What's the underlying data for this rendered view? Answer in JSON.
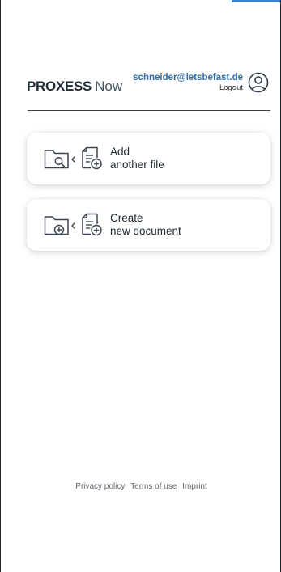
{
  "app": {
    "logo_brand": "PROXESS",
    "logo_suffix": "Now"
  },
  "account": {
    "email": "schneider@letsbefast.de",
    "logout_label": "Logout",
    "avatar_icon": "user-circle-icon"
  },
  "actions": [
    {
      "line1": "Add",
      "line2": "another file",
      "icons": [
        "folder-search-icon",
        "chevron-left-icon",
        "document-add-icon"
      ]
    },
    {
      "line1": "Create",
      "line2": "new document",
      "icons": [
        "folder-add-icon",
        "chevron-left-icon",
        "document-add-icon"
      ]
    }
  ],
  "footer": {
    "privacy": "Privacy policy",
    "terms": "Terms of use",
    "imprint": "Imprint"
  },
  "colors": {
    "accent": "#2f6fad",
    "icon_stroke": "#3a4450",
    "tab_blue": "#3f82c6"
  }
}
